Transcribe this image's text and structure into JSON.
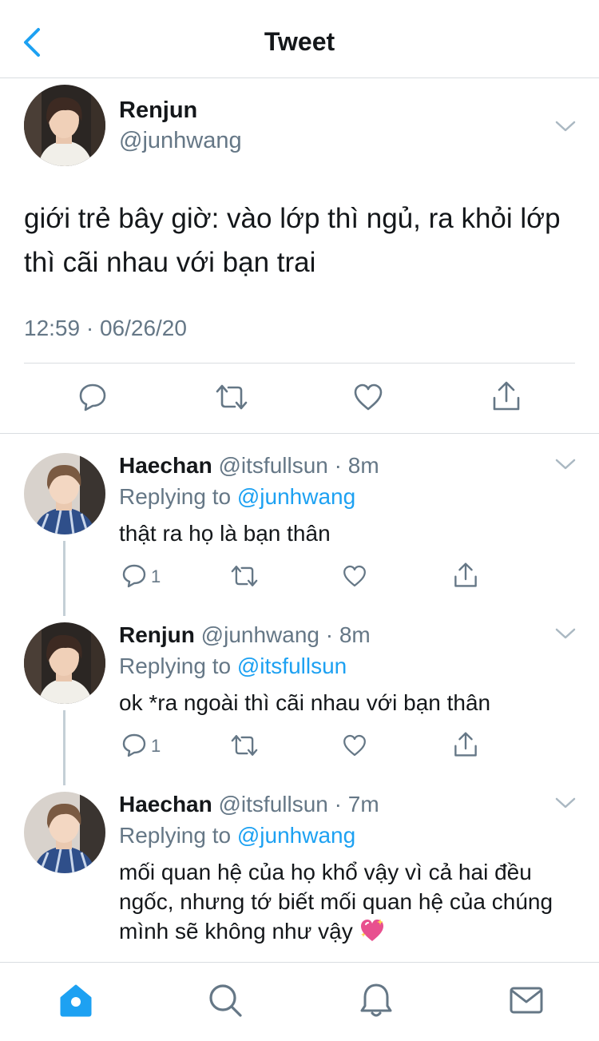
{
  "header": {
    "title": "Tweet",
    "back_icon": "chevron-left-icon"
  },
  "tweet": {
    "name": "Renjun",
    "handle": "@junhwang",
    "text": "giới trẻ bây giờ: vào lớp thì ngủ, ra khỏi lớp thì cãi nhau với bạn trai",
    "timestamp": "12:59 · 06/26/20"
  },
  "replies": [
    {
      "name": "Haechan",
      "meta": "@itsfullsun · 8m",
      "replying_prefix": "Replying to ",
      "replying_to": "@junhwang",
      "text": "thật ra họ là bạn thân",
      "reply_count": "1"
    },
    {
      "name": "Renjun",
      "meta": "@junhwang · 8m",
      "replying_prefix": "Replying to ",
      "replying_to": "@itsfullsun",
      "text": "ok *ra ngoài thì cãi nhau với bạn thân",
      "reply_count": "1"
    },
    {
      "name": "Haechan",
      "meta": "@itsfullsun · 7m",
      "replying_prefix": "Replying to ",
      "replying_to": "@junhwang",
      "text": "mối quan hệ của họ khổ vậy vì cả hai đều ngốc, nhưng tớ biết mối quan hệ của chúng mình sẽ không như vậy",
      "emoji": "sparkling-heart-icon"
    }
  ],
  "tabbar": [
    "home-icon",
    "search-icon",
    "notifications-icon",
    "messages-icon"
  ],
  "colors": {
    "accent": "#1da1f2",
    "secondary_text": "#657786",
    "divider": "#d9dde1",
    "heart_pink": "#e8508f"
  }
}
